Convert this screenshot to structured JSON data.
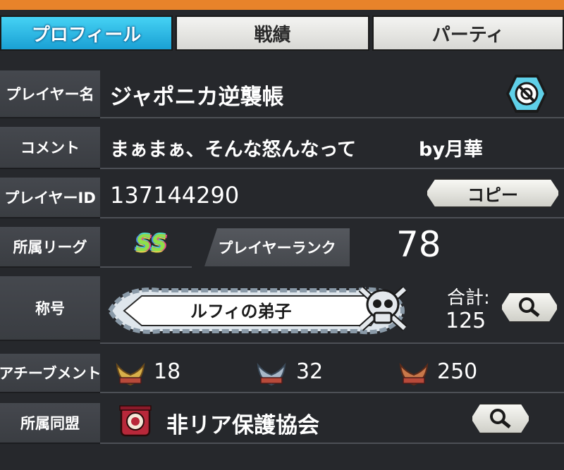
{
  "tabs": [
    {
      "label": "プロフィール",
      "active": true
    },
    {
      "label": "戦績",
      "active": false
    },
    {
      "label": "パーティ",
      "active": false
    }
  ],
  "rows": {
    "player_name": {
      "label": "プレイヤー名",
      "value": "ジャポニカ逆襲帳"
    },
    "comment": {
      "label": "コメント",
      "value": "まぁまぁ、そんな怒んなって",
      "signature": "by月華"
    },
    "player_id": {
      "label": "プレイヤーID",
      "value": "137144290",
      "copy_button": "コピー"
    },
    "league": {
      "label": "所属リーグ",
      "league_badge": "SS"
    },
    "rank": {
      "label": "プレイヤーランク",
      "value": "78"
    },
    "title": {
      "label": "称号",
      "value": "ルフィの弟子",
      "total_label": "合計:",
      "total_value": "125"
    },
    "achievement": {
      "label": "アチーブメント",
      "gold": "18",
      "silver": "32",
      "bronze": "250"
    },
    "alliance": {
      "label": "所属同盟",
      "value": "非リア保護協会"
    }
  },
  "colors": {
    "tab_active": "#1aa0d4",
    "background": "#26282c",
    "label_bg": "#3f4247",
    "accent_orange": "#e8832a",
    "gold": "#d8b04a",
    "silver": "#a8b8c8",
    "bronze": "#c8784a"
  },
  "icons": [
    "no-entry-icon",
    "search-icon",
    "skull-icon",
    "laurel-icon",
    "alliance-flag-icon"
  ]
}
